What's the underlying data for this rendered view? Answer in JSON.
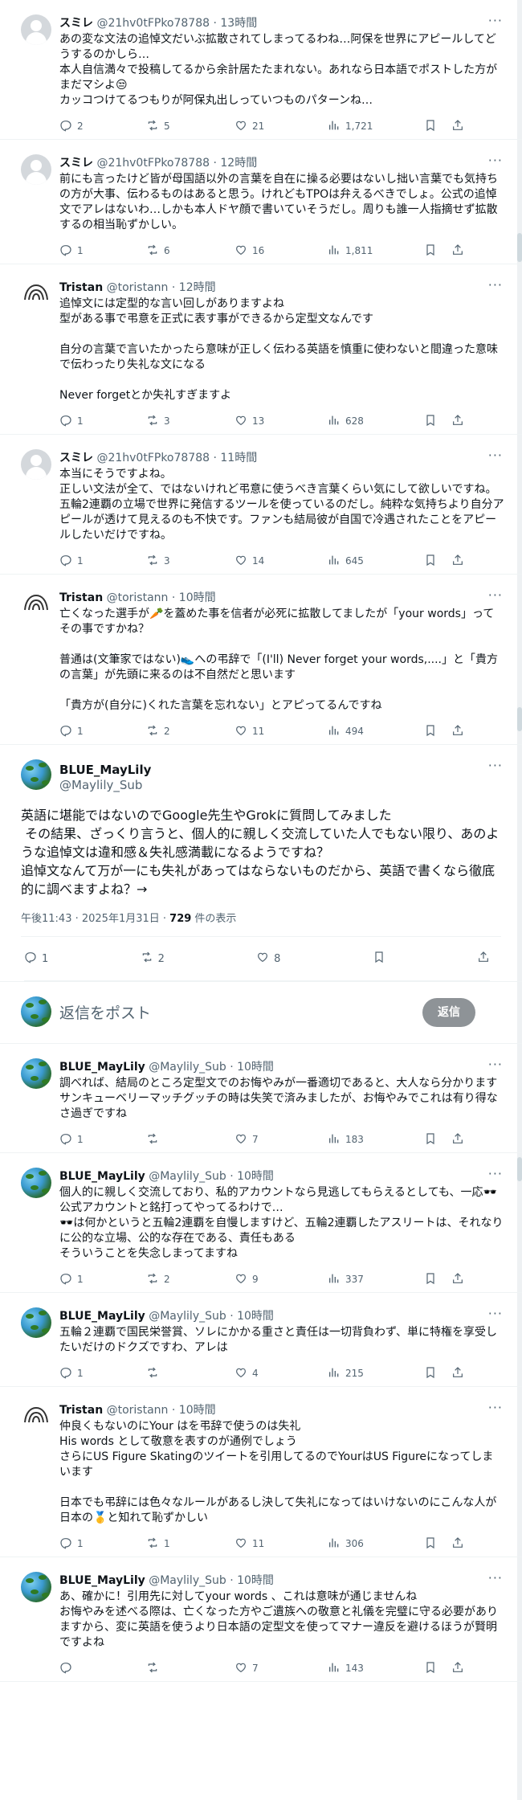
{
  "posts_above": [
    {
      "avatar": "default-avatar",
      "name": "スミレ",
      "handle": "@21hv0tFPko78788",
      "time": "13時間",
      "text": "あの変な文法の追悼文だいぶ拡散されてしまってるわね…阿保を世界にアピールしてどうするのかしら…\n本人自信満々で投稿してるから余計居たたまれない。あれなら日本語でポストした方がまだマシよ😒\nカッコつけてるつもりが阿保丸出しっていつものパターンね…",
      "replies": "2",
      "reposts": "5",
      "likes": "21",
      "views": "1,721"
    },
    {
      "avatar": "default-avatar",
      "name": "スミレ",
      "handle": "@21hv0tFPko78788",
      "time": "12時間",
      "text": "前にも言ったけど皆が母国語以外の言葉を自在に操る必要はないし拙い言葉でも気持ちの方が大事、伝わるものはあると思う。けれどもTPOは弁えるべきでしょ。公式の追悼文でアレはないわ…しかも本人ドヤ顔で書いていそうだし。周りも誰一人指摘せず拡散するの相当恥ずかしい。",
      "replies": "1",
      "reposts": "6",
      "likes": "16",
      "views": "1,811"
    },
    {
      "avatar": "tristan-avatar",
      "name": "Tristan",
      "handle": "@toristann",
      "time": "12時間",
      "text": "追悼文には定型的な言い回しがありますよね\n型がある事で弔意を正式に表す事ができるから定型文なんです\n\n自分の言葉で言いたかったら意味が正しく伝わる英語を慎重に使わないと間違った意味で伝わったり失礼な文になる\n\nNever forgetとか失礼すぎますよ",
      "replies": "1",
      "reposts": "3",
      "likes": "13",
      "views": "628"
    },
    {
      "avatar": "default-avatar",
      "name": "スミレ",
      "handle": "@21hv0tFPko78788",
      "time": "11時間",
      "text": "本当にそうですよね。\n正しい文法が全て、ではないけれど弔意に使うべき言葉くらい気にして欲しいですね。五輪2連覇の立場で世界に発信するツールを使っているのだし。純粋な気持ちより自分アピールが透けて見えるのも不快です。ファンも結局彼が自国で冷遇されたことをアピールしたいだけですね。",
      "replies": "1",
      "reposts": "3",
      "likes": "14",
      "views": "645"
    },
    {
      "avatar": "tristan-avatar",
      "name": "Tristan",
      "handle": "@toristann",
      "time": "10時間",
      "text": "亡くなった選手が🥕を蓋めた事を信者が必死に拡散してましたが「your words」ってその事ですかね？\n\n普通は(文筆家ではない)👟への弔辞で「(I'll) Never forget your words,....」と「貴方の言葉」が先頭に来るのは不自然だと思います\n\n「貴方が(自分に)くれた言葉を忘れない」とアピってるんですね",
      "replies": "1",
      "reposts": "2",
      "likes": "11",
      "views": "494"
    }
  ],
  "main_post": {
    "name": "BLUE_MayLily",
    "handle": "@Maylily_Sub",
    "text": "英語に堪能ではないのでGoogle先生やGrokに質問してみました\n その結果、ざっくり言うと、個人的に親しく交流していた人でもない限り、あのような追悼文は違和感＆失礼感満載になるようですね？\n追悼文なんて万が一にも失礼があってはならないものだから、英語で書くなら徹底的に調べますよね？→",
    "date": "午後11:43 · 2025年1月31日 · ",
    "views_count": "729",
    "views_label": " 件の表示",
    "replies": "1",
    "reposts": "2",
    "likes": "8"
  },
  "reply_box": {
    "placeholder": "返信をポスト",
    "button": "返信"
  },
  "replies_below": [
    {
      "avatar": "blue-avatar",
      "name": "BLUE_MayLily",
      "handle": "@Maylily_Sub",
      "time": "10時間",
      "text": "調べれば、結局のところ定型文でのお悔やみが一番適切であると、大人なら分かります\nサンキューベリーマッチグッチの時は失笑で済みましたが、お悔やみでこれは有り得なさ過ぎですね",
      "replies": "1",
      "reposts": "",
      "likes": "7",
      "views": "183"
    },
    {
      "avatar": "blue-avatar",
      "name": "BLUE_MayLily",
      "handle": "@Maylily_Sub",
      "time": "10時間",
      "text": "個人的に親しく交流しており、私的アカウントなら見逃してもらえるとしても、一応🕶️公式アカウントと銘打ってやってるわけで…\n🕶️は何かというと五輪2連覇を自慢しますけど、五輪2連覇したアスリートは、それなりに公的な立場、公的な存在である、責任もある\nそういうことを失念しまってますね",
      "replies": "1",
      "reposts": "2",
      "likes": "9",
      "views": "337"
    },
    {
      "avatar": "blue-avatar",
      "name": "BLUE_MayLily",
      "handle": "@Maylily_Sub",
      "time": "10時間",
      "text": "五輪２連覇で国民栄誉賞、ソレにかかる重さと責任は一切背負わず、単に特権を享受したいだけのドクズですわ、アレは",
      "replies": "1",
      "reposts": "",
      "likes": "4",
      "views": "215"
    },
    {
      "avatar": "tristan-avatar",
      "name": "Tristan",
      "handle": "@toristann",
      "time": "10時間",
      "text": "仲良くもないのにYour はを弔辞で使うのは失礼\nHis words として敬意を表すのが通例でしょう\nさらにUS Figure Skatingのツイートを引用してるのでYourはUS Figureになってしまいます\n\n日本でも弔辞には色々なルールがあるし決して失礼になってはいけないのにこんな人が日本の🥇と知れて恥ずかしい",
      "replies": "1",
      "reposts": "1",
      "likes": "11",
      "views": "306"
    },
    {
      "avatar": "blue-avatar",
      "name": "BLUE_MayLily",
      "handle": "@Maylily_Sub",
      "time": "10時間",
      "text": "あ、確かに！引用先に対してyour words 、これは意味が通じませんね\nお悔やみを述べる際は、亡くなった方やご遺族への敬意と礼儀を完璧に守る必要がありますから、変に英語を使うより日本語の定型文を使ってマナー違反を避けるほうが賢明ですよね",
      "replies": "",
      "reposts": "",
      "likes": "7",
      "views": "143"
    }
  ],
  "colors": {
    "text": "#0f1419",
    "muted": "#536471",
    "border": "#eff3f4",
    "reply_button": "#8e9397"
  }
}
